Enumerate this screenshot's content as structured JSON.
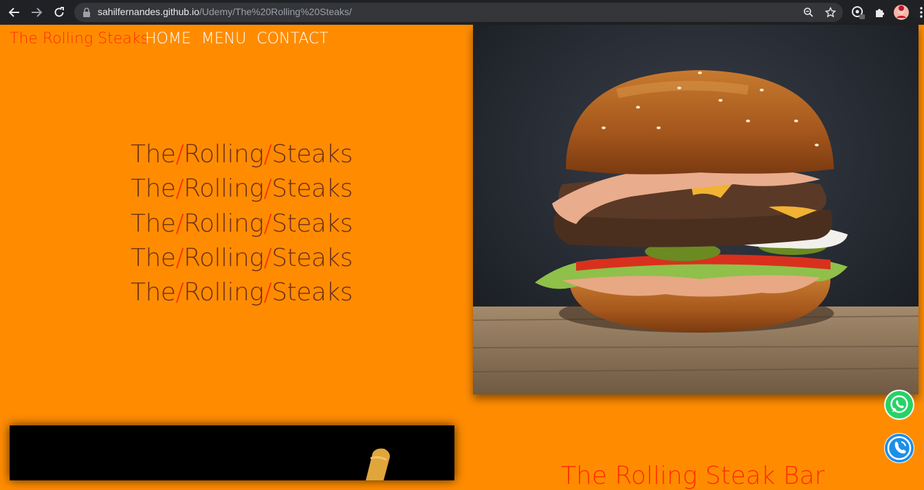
{
  "browser": {
    "url_host": "sahilfernandes.github.io",
    "url_path": "/Udemy/The%20Rolling%20Steaks/"
  },
  "header": {
    "brand": "The Rolling Steaks",
    "nav": [
      "HOME",
      "MENU",
      "CONTACT"
    ]
  },
  "hero": {
    "word1": "The",
    "word2": "Rolling",
    "word3": "Steaks",
    "separator": "/",
    "line_count": 5,
    "image": "burger-photo"
  },
  "section": {
    "image": "fries-photo",
    "title": "The Rolling Steak Bar"
  },
  "floating": {
    "whatsapp": "whatsapp-icon",
    "call": "phone-icon"
  },
  "colors": {
    "background": "#ff8c00",
    "brand_red": "#ff2a00",
    "hero_text": "#6b2e1a"
  }
}
